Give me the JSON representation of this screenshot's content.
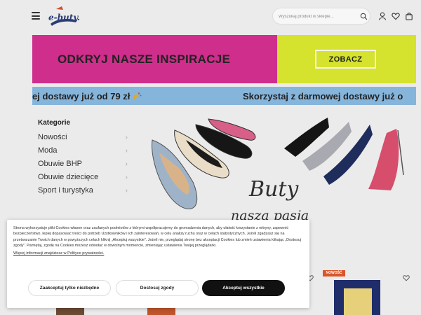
{
  "header": {
    "logo_text": "e-buty.pl",
    "search_placeholder": "Wyszukaj produkt w sklepie...",
    "icons": [
      "menu-icon",
      "search-icon",
      "user-icon",
      "heart-icon",
      "bag-icon"
    ]
  },
  "banner": {
    "headline": "ODKRYJ NASZE INSPIRACJE",
    "button_label": "ZOBACZ",
    "colors": {
      "left": "#cf2e8c",
      "right": "#d5e22e"
    }
  },
  "ticker": {
    "message_1": "ej dostawy już od 79 zł",
    "message_2": "Skorzystaj z darmowej dostawy już o"
  },
  "sidebar": {
    "title": "Kategorie",
    "items": [
      {
        "label": "Nowości"
      },
      {
        "label": "Moda"
      },
      {
        "label": "Obuwie BHP"
      },
      {
        "label": "Obuwie dziecięce"
      },
      {
        "label": "Sport i turystyka"
      }
    ]
  },
  "hero": {
    "line_1": "Buty",
    "line_2": "nasza pasja"
  },
  "cookie": {
    "text": "Strona wykorzystuje pliki Cookies własne oraz zaufanych podmiotów z którymi współpracujemy do gromadzenia danych, aby ułatwić korzystanie z witryny, zapewnić bezpieczeństwo, lepiej dopasować treści do potrzeb Użytkowników i ich zainteresowań, w celu analizy ruchu oraz w celach statystycznych. Jeżeli zgadzasz się na przetwarzanie Twoich danych w powyższych celach kliknij „Akceptuj wszystkie”. Jeżeli nie, przeglądaj stronę bez akceptacji Cookies lub zmień ustawienia klikając „Dostosuj zgody”. Pamiętaj, zgodę na Cookies możesz odwołać w dowolnym momencie, zmieniając ustawienia Twojej przeglądarki.",
    "link": "Więcej informacji znajdziesz w Polityce prywatności.",
    "btn_necessary": "Zaakceptuj tylko niezbędne",
    "btn_settings": "Dostosuj zgody",
    "btn_accept": "Akceptuj wszystkie"
  },
  "products": {
    "badge_new": "NOWOŚĆ"
  }
}
